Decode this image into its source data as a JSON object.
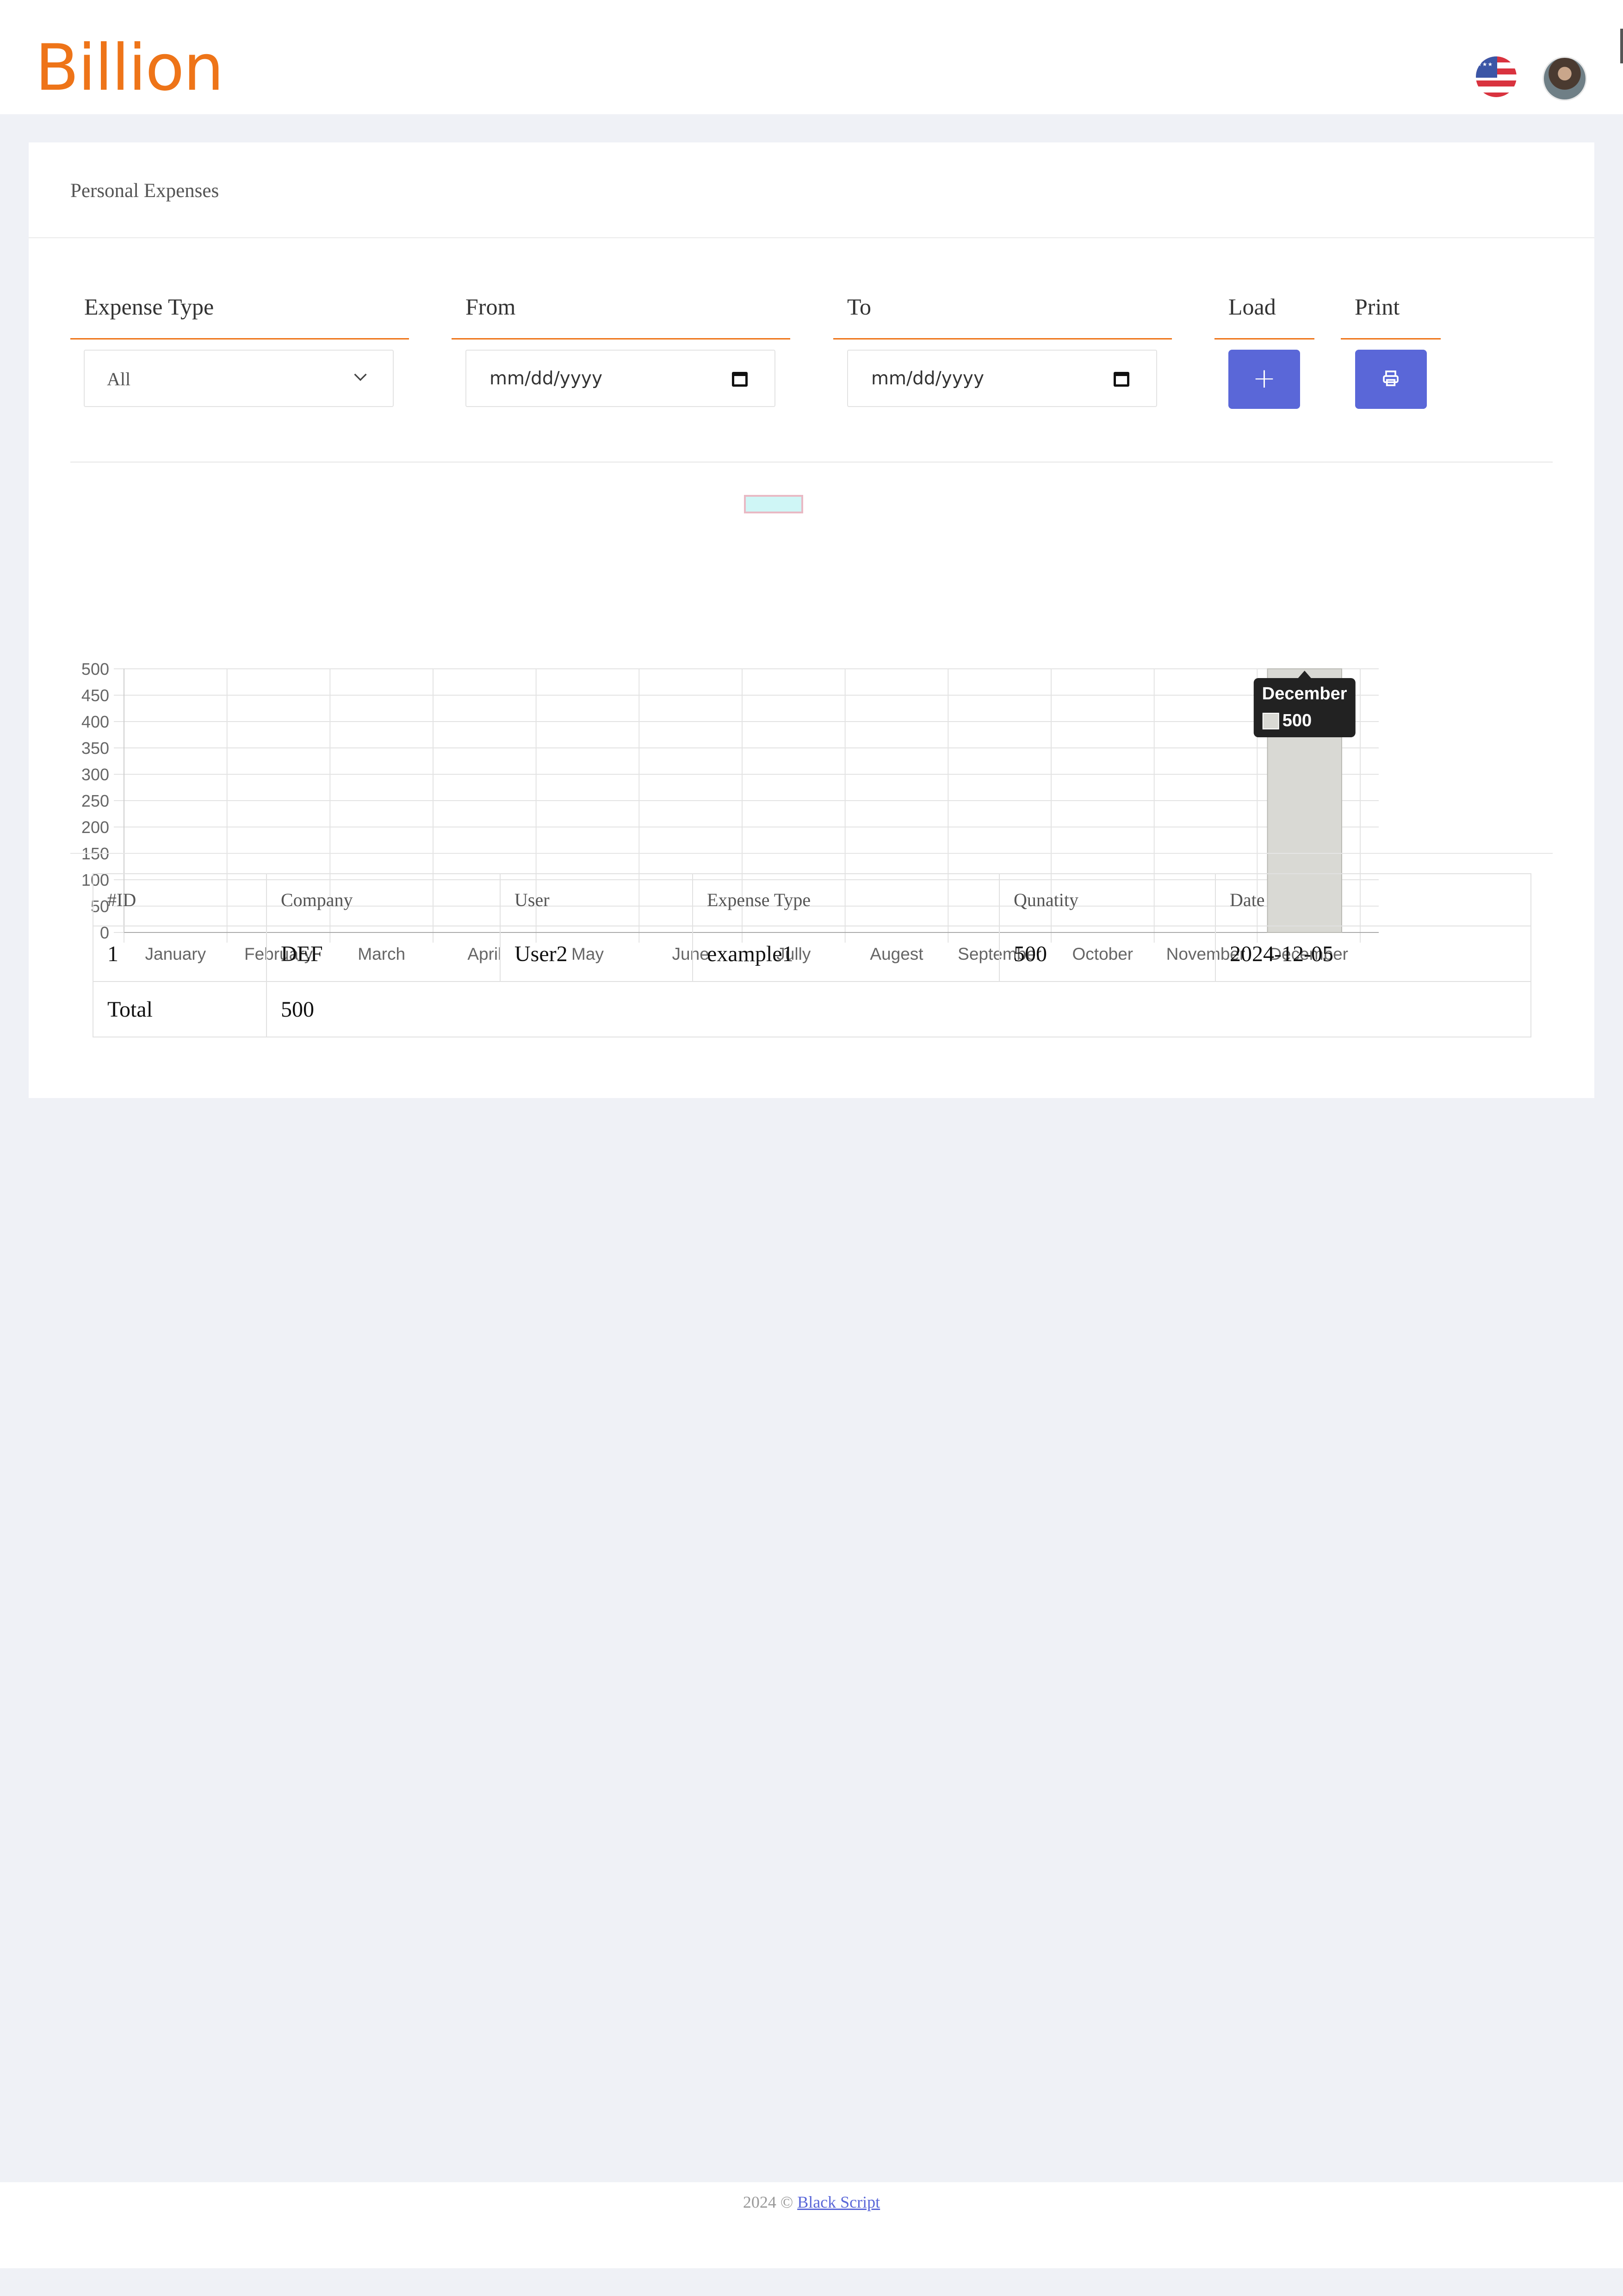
{
  "header": {
    "logo_text": "Billion",
    "flag_icon": "us-flag-icon",
    "avatar_icon": "user-avatar"
  },
  "page": {
    "title": "Personal Expenses"
  },
  "filters": {
    "expense_type_label": "Expense Type",
    "expense_type_value": "All",
    "from_label": "From",
    "from_placeholder": "mm/dd/yyyy",
    "to_label": "To",
    "to_placeholder": "mm/dd/yyyy",
    "load_label": "Load",
    "print_label": "Print",
    "load_icon": "plus-icon",
    "print_icon": "printer-icon"
  },
  "colors": {
    "accent": "#ee7418",
    "button": "#5a67d8",
    "legend_fill": "#cff6f6",
    "legend_border": "#e9b9c4",
    "highlight_bar": "#d9d9d4",
    "tooltip_bg": "#222222"
  },
  "chart_data": {
    "type": "bar",
    "categories": [
      "January",
      "February",
      "March",
      "April",
      "May",
      "June",
      "Jully",
      "Augest",
      "September",
      "October",
      "November",
      "December"
    ],
    "series": [
      {
        "values": [
          0,
          0,
          0,
          0,
          0,
          0,
          0,
          0,
          0,
          0,
          0,
          500
        ]
      }
    ],
    "ylim": [
      0,
      500
    ],
    "yticks": [
      0,
      50,
      100,
      150,
      200,
      250,
      300,
      350,
      400,
      450,
      500
    ],
    "grid": true,
    "tooltip": {
      "title": "December",
      "value": "500"
    }
  },
  "table": {
    "headers": [
      "#ID",
      "Company",
      "User",
      "Expense Type",
      "Qunatity",
      "Date"
    ],
    "rows": [
      [
        "1",
        "DEF",
        "User2",
        "example1",
        "500",
        "2024-12-05"
      ]
    ],
    "total_label": "Total",
    "total_value": "500"
  },
  "footer": {
    "prefix": "2024 © ",
    "link_text": "Black Script"
  }
}
